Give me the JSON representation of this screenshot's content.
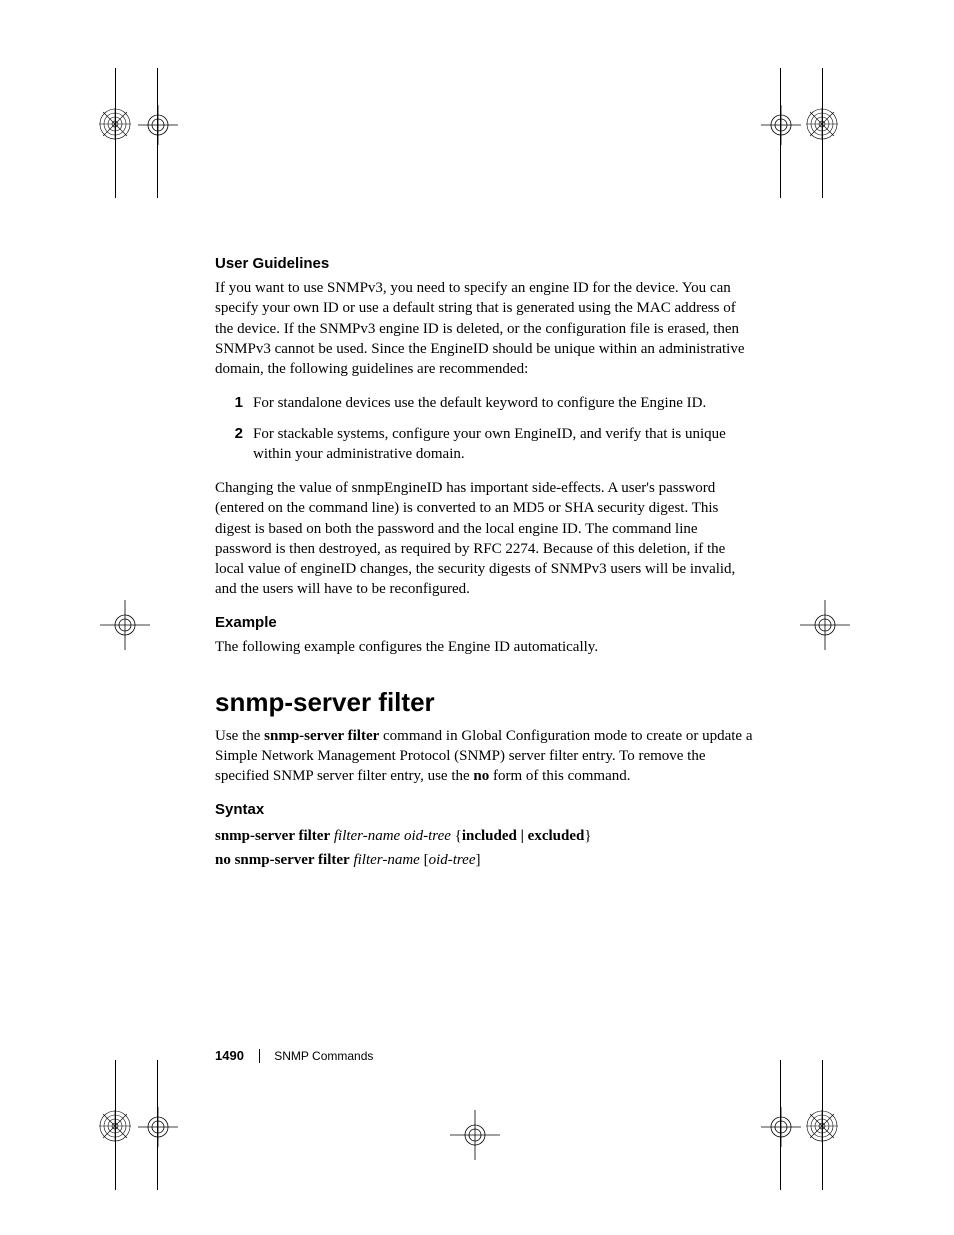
{
  "sections": {
    "user_guidelines": {
      "heading": "User Guidelines",
      "para1": "If you want to use SNMPv3, you need to specify an engine ID for the device. You can specify your own ID or use a default string that is generated using the MAC address of the device. If the SNMPv3 engine ID is deleted, or the configuration file is erased, then SNMPv3 cannot be used. Since the EngineID should be unique within an administrative domain, the following guidelines are recommended:",
      "list": [
        {
          "num": "1",
          "text": "For standalone devices use the default keyword to configure the Engine ID."
        },
        {
          "num": "2",
          "text": "For stackable systems, configure your own EngineID, and verify that is unique within your administrative domain."
        }
      ],
      "para2": "Changing the value of snmpEngineID has important side-effects. A user's password (entered on the command line) is converted to an MD5 or SHA security digest. This digest is based on both the password and the local engine ID. The command line password is then destroyed, as required by RFC 2274. Because of this deletion, if the local value of engineID changes, the security digests of SNMPv3 users will be invalid, and the users will have to be reconfigured."
    },
    "example": {
      "heading": "Example",
      "para": "The following example configures the Engine ID automatically."
    },
    "command": {
      "title": "snmp-server filter",
      "desc_pre": "Use the ",
      "desc_bold": "snmp-server filter",
      "desc_mid": " command in Global Configuration mode to create or update a Simple Network Management Protocol (SNMP) server filter entry. To remove the specified SNMP server filter entry, use the ",
      "desc_bold2": "no",
      "desc_post": " form of this command."
    },
    "syntax": {
      "heading": "Syntax",
      "line1": {
        "cmd": "snmp-server filter",
        "arg1": "filter-name oid-tree",
        "opts": "included | excluded"
      },
      "line2": {
        "cmd": "no snmp-server filter",
        "arg1": "filter-name",
        "arg2": "oid-tree"
      }
    }
  },
  "footer": {
    "page_number": "1490",
    "section": "SNMP Commands"
  }
}
